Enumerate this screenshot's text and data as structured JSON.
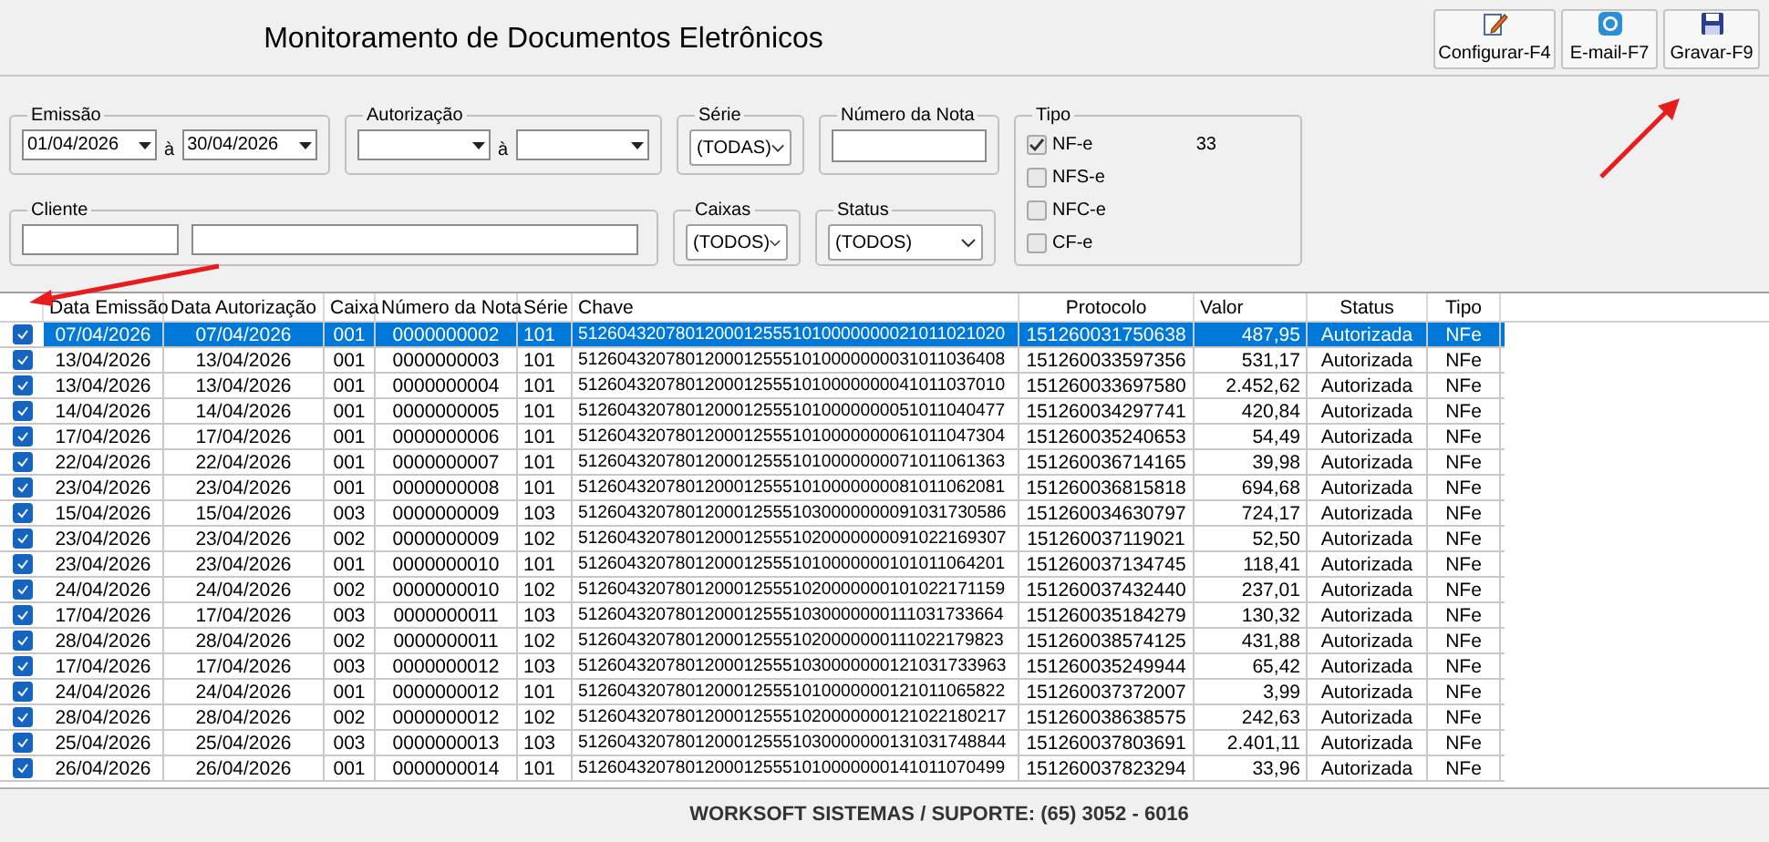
{
  "title": "Monitoramento de Documentos Eletrônicos",
  "toolbar": [
    {
      "label": "Configurar-F4",
      "kind": "config"
    },
    {
      "label": "E-mail-F7",
      "kind": "email"
    },
    {
      "label": "Gravar-F9",
      "kind": "save"
    }
  ],
  "filters": {
    "emissao": {
      "label": "Emissão",
      "from": "01/04/2026",
      "separator": "à",
      "to": "30/04/2026"
    },
    "autorizacao": {
      "label": "Autorização",
      "separator": "à"
    },
    "serie": {
      "label": "Série",
      "value": "(TODAS)"
    },
    "numero_nota": {
      "label": "Número da Nota"
    },
    "cliente": {
      "label": "Cliente"
    },
    "caixas": {
      "label": "Caixas",
      "value": "(TODOS)"
    },
    "status": {
      "label": "Status",
      "value": "(TODOS)"
    },
    "tipo": {
      "label": "Tipo",
      "count": "33",
      "options": [
        {
          "label": "NF-e",
          "checked": true
        },
        {
          "label": "NFS-e",
          "checked": false
        },
        {
          "label": "NFC-e",
          "checked": false
        },
        {
          "label": "CF-e",
          "checked": false
        }
      ]
    }
  },
  "table": {
    "columns": [
      "Data Emissão",
      "Data Autorização",
      "Caixa",
      "Número da Nota",
      "Série",
      "Chave",
      "Protocolo",
      "Valor",
      "Status",
      "Tipo"
    ],
    "rows": [
      {
        "checked": true,
        "selected": true,
        "cells": [
          "07/04/2026",
          "07/04/2026",
          "001",
          "0000000002",
          "101",
          "51260432078012000125551010000000021011021020",
          "151260031750638",
          "487,95",
          "Autorizada",
          "NFe"
        ]
      },
      {
        "checked": true,
        "selected": false,
        "cells": [
          "13/04/2026",
          "13/04/2026",
          "001",
          "0000000003",
          "101",
          "51260432078012000125551010000000031011036408",
          "151260033597356",
          "531,17",
          "Autorizada",
          "NFe"
        ]
      },
      {
        "checked": true,
        "selected": false,
        "cells": [
          "13/04/2026",
          "13/04/2026",
          "001",
          "0000000004",
          "101",
          "51260432078012000125551010000000041011037010",
          "151260033697580",
          "2.452,62",
          "Autorizada",
          "NFe"
        ]
      },
      {
        "checked": true,
        "selected": false,
        "cells": [
          "14/04/2026",
          "14/04/2026",
          "001",
          "0000000005",
          "101",
          "51260432078012000125551010000000051011040477",
          "151260034297741",
          "420,84",
          "Autorizada",
          "NFe"
        ]
      },
      {
        "checked": true,
        "selected": false,
        "cells": [
          "17/04/2026",
          "17/04/2026",
          "001",
          "0000000006",
          "101",
          "51260432078012000125551010000000061011047304",
          "151260035240653",
          "54,49",
          "Autorizada",
          "NFe"
        ]
      },
      {
        "checked": true,
        "selected": false,
        "cells": [
          "22/04/2026",
          "22/04/2026",
          "001",
          "0000000007",
          "101",
          "51260432078012000125551010000000071011061363",
          "151260036714165",
          "39,98",
          "Autorizada",
          "NFe"
        ]
      },
      {
        "checked": true,
        "selected": false,
        "cells": [
          "23/04/2026",
          "23/04/2026",
          "001",
          "0000000008",
          "101",
          "51260432078012000125551010000000081011062081",
          "151260036815818",
          "694,68",
          "Autorizada",
          "NFe"
        ]
      },
      {
        "checked": true,
        "selected": false,
        "cells": [
          "15/04/2026",
          "15/04/2026",
          "003",
          "0000000009",
          "103",
          "51260432078012000125551030000000091031730586",
          "151260034630797",
          "724,17",
          "Autorizada",
          "NFe"
        ]
      },
      {
        "checked": true,
        "selected": false,
        "cells": [
          "23/04/2026",
          "23/04/2026",
          "002",
          "0000000009",
          "102",
          "51260432078012000125551020000000091022169307",
          "151260037119021",
          "52,50",
          "Autorizada",
          "NFe"
        ]
      },
      {
        "checked": true,
        "selected": false,
        "cells": [
          "23/04/2026",
          "23/04/2026",
          "001",
          "0000000010",
          "101",
          "51260432078012000125551010000000101011064201",
          "151260037134745",
          "118,41",
          "Autorizada",
          "NFe"
        ]
      },
      {
        "checked": true,
        "selected": false,
        "cells": [
          "24/04/2026",
          "24/04/2026",
          "002",
          "0000000010",
          "102",
          "51260432078012000125551020000000101022171159",
          "151260037432440",
          "237,01",
          "Autorizada",
          "NFe"
        ]
      },
      {
        "checked": true,
        "selected": false,
        "cells": [
          "17/04/2026",
          "17/04/2026",
          "003",
          "0000000011",
          "103",
          "51260432078012000125551030000000111031733664",
          "151260035184279",
          "130,32",
          "Autorizada",
          "NFe"
        ]
      },
      {
        "checked": true,
        "selected": false,
        "cells": [
          "28/04/2026",
          "28/04/2026",
          "002",
          "0000000011",
          "102",
          "51260432078012000125551020000000111022179823",
          "151260038574125",
          "431,88",
          "Autorizada",
          "NFe"
        ]
      },
      {
        "checked": true,
        "selected": false,
        "cells": [
          "17/04/2026",
          "17/04/2026",
          "003",
          "0000000012",
          "103",
          "51260432078012000125551030000000121031733963",
          "151260035249944",
          "65,42",
          "Autorizada",
          "NFe"
        ]
      },
      {
        "checked": true,
        "selected": false,
        "cells": [
          "24/04/2026",
          "24/04/2026",
          "001",
          "0000000012",
          "101",
          "51260432078012000125551010000000121011065822",
          "151260037372007",
          "3,99",
          "Autorizada",
          "NFe"
        ]
      },
      {
        "checked": true,
        "selected": false,
        "cells": [
          "28/04/2026",
          "28/04/2026",
          "002",
          "0000000012",
          "102",
          "51260432078012000125551020000000121022180217",
          "151260038638575",
          "242,63",
          "Autorizada",
          "NFe"
        ]
      },
      {
        "checked": true,
        "selected": false,
        "cells": [
          "25/04/2026",
          "25/04/2026",
          "003",
          "0000000013",
          "103",
          "51260432078012000125551030000000131031748844",
          "151260037803691",
          "2.401,11",
          "Autorizada",
          "NFe"
        ]
      },
      {
        "checked": true,
        "selected": false,
        "cells": [
          "26/04/2026",
          "26/04/2026",
          "001",
          "0000000014",
          "101",
          "51260432078012000125551010000000141011070499",
          "151260037823294",
          "33,96",
          "Autorizada",
          "NFe"
        ]
      }
    ]
  },
  "footer": "WORKSOFT SISTEMAS / SUPORTE: (65) 3052 - 6016"
}
